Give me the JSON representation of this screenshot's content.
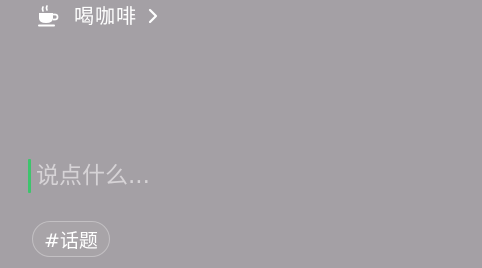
{
  "activity": {
    "icon": "coffee-cup-icon",
    "label": "喝咖啡"
  },
  "compose": {
    "placeholder": "说点什么...",
    "value": "",
    "caret_color": "#3ec46d"
  },
  "topic_button": {
    "label": "#话题"
  }
}
